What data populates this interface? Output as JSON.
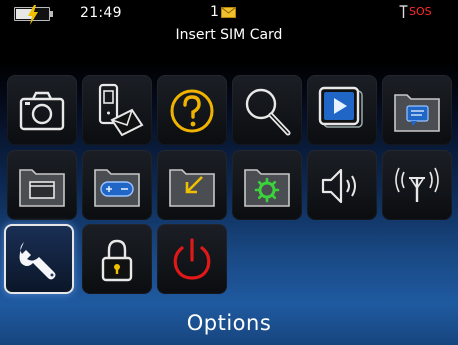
{
  "status": {
    "time": "21:49",
    "message_count": "1",
    "notice": "Insert SIM Card",
    "signal_text": "SOS",
    "battery_level": 0.55
  },
  "icons": [
    {
      "name": "camera-icon",
      "selected": false
    },
    {
      "name": "media-transfer-icon",
      "selected": false
    },
    {
      "name": "help-icon",
      "selected": false
    },
    {
      "name": "search-icon",
      "selected": false
    },
    {
      "name": "media-play-icon",
      "selected": false
    },
    {
      "name": "messages-folder-icon",
      "selected": false
    },
    {
      "name": "folder-window-icon",
      "selected": false
    },
    {
      "name": "games-folder-icon",
      "selected": false
    },
    {
      "name": "downloads-folder-icon",
      "selected": false
    },
    {
      "name": "applications-folder-icon",
      "selected": false
    },
    {
      "name": "sound-profile-icon",
      "selected": false
    },
    {
      "name": "manage-connections-icon",
      "selected": false
    },
    {
      "name": "options-wrench-icon",
      "selected": true
    },
    {
      "name": "lock-icon",
      "selected": false
    },
    {
      "name": "power-icon",
      "selected": false
    }
  ],
  "selected_label": "Options",
  "colors": {
    "accent_blue": "#2a7bd8",
    "sos_red": "#ff2b2b",
    "help_yellow": "#f0b400",
    "power_red": "#e01818",
    "gear_green": "#3bd13b",
    "download_yellow": "#f0c000",
    "envelope_yellow": "#f1c12c"
  }
}
